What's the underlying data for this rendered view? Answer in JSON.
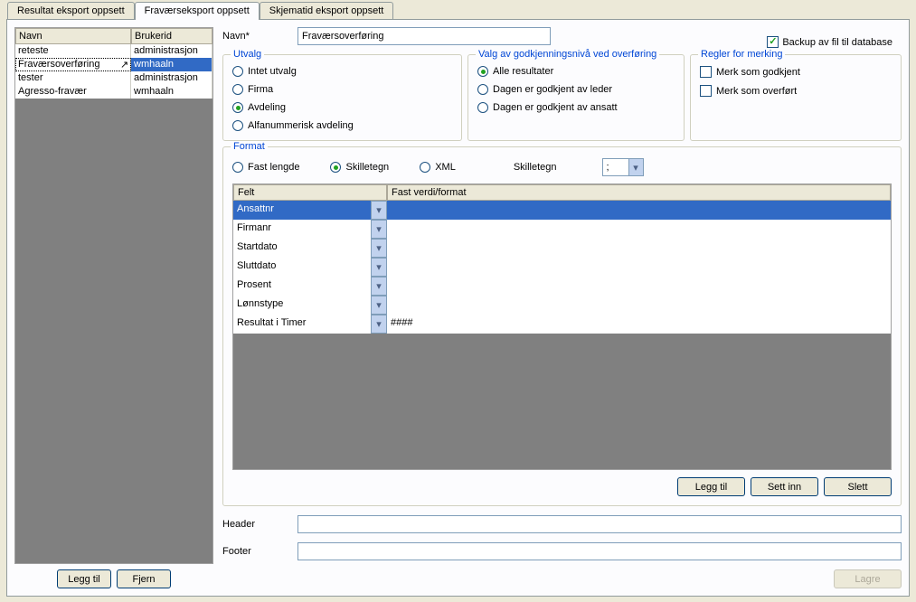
{
  "tabs": [
    "Resultat eksport oppsett",
    "Fraværseksport oppsett",
    "Skjematid eksport oppsett"
  ],
  "activeTab": 1,
  "leftGrid": {
    "headers": {
      "name": "Navn",
      "user": "Brukerid"
    },
    "rows": [
      {
        "name": "reteste",
        "user": "administrasjon"
      },
      {
        "name": "Fraværsoverføring",
        "user": "wmhaaln"
      },
      {
        "name": "tester",
        "user": "administrasjon"
      },
      {
        "name": "Agresso-fravær",
        "user": "wmhaaln"
      }
    ],
    "selectedIndex": 1
  },
  "leftButtons": {
    "add": "Legg til",
    "remove": "Fjern"
  },
  "nameField": {
    "label": "Navn*",
    "value": "Fraværsoverføring"
  },
  "backup": {
    "label": "Backup av fil til database",
    "checked": true
  },
  "utvalg": {
    "title": "Utvalg",
    "options": [
      "Intet utvalg",
      "Firma",
      "Avdeling",
      "Alfanummerisk avdeling"
    ],
    "selectedIndex": 2
  },
  "valg": {
    "title": "Valg av godkjenningsnivå ved overføring",
    "options": [
      "Alle resultater",
      "Dagen er godkjent av leder",
      "Dagen er godkjent av ansatt"
    ],
    "selectedIndex": 0
  },
  "regler": {
    "title": "Regler for merking",
    "options": [
      {
        "label": "Merk som godkjent",
        "checked": false
      },
      {
        "label": "Merk som overført",
        "checked": false
      }
    ]
  },
  "format": {
    "title": "Format",
    "types": [
      "Fast lengde",
      "Skilletegn",
      "XML"
    ],
    "typeSelectedIndex": 1,
    "skilletegnLabel": "Skilletegn",
    "skilletegnValue": ";",
    "headers": {
      "felt": "Felt",
      "fast": "Fast verdi/format"
    },
    "rows": [
      {
        "felt": "Ansattnr",
        "fast": ""
      },
      {
        "felt": "Firmanr",
        "fast": ""
      },
      {
        "felt": "Startdato",
        "fast": ""
      },
      {
        "felt": "Sluttdato",
        "fast": ""
      },
      {
        "felt": "Prosent",
        "fast": ""
      },
      {
        "felt": "Lønnstype",
        "fast": ""
      },
      {
        "felt": "Resultat i Timer",
        "fast": "####"
      }
    ],
    "selectedIndex": 0,
    "buttons": {
      "add": "Legg til",
      "insert": "Sett inn",
      "del": "Slett"
    }
  },
  "header": {
    "label": "Header",
    "value": ""
  },
  "footer": {
    "label": "Footer",
    "value": ""
  },
  "save": "Lagre"
}
